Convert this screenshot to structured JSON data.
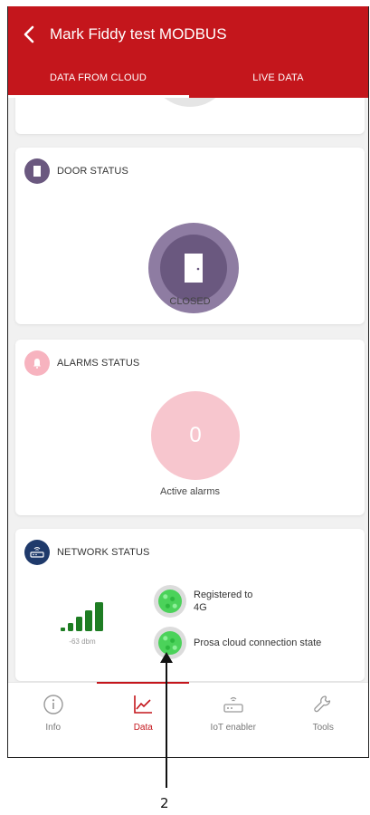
{
  "header": {
    "title": "Mark Fiddy test MODBUS",
    "tabs": [
      {
        "label": "DATA FROM CLOUD",
        "active": true
      },
      {
        "label": "LIVE DATA",
        "active": false
      }
    ]
  },
  "door": {
    "title": "DOOR STATUS",
    "state": "CLOSED",
    "icon": "door-icon"
  },
  "alarms": {
    "title": "ALARMS STATUS",
    "count": "0",
    "label": "Active alarms",
    "icon": "bell-icon"
  },
  "network": {
    "title": "NETWORK STATUS",
    "signal_strength": "-63 dbm",
    "icon": "router-icon",
    "statuses": [
      {
        "label": "Registered to 4G",
        "line1": "Registered to",
        "line2": "4G",
        "state": "green"
      },
      {
        "label": "Prosa cloud connection state",
        "state": "green"
      }
    ]
  },
  "bottom_nav": [
    {
      "label": "Info",
      "icon": "info-icon",
      "active": false
    },
    {
      "label": "Data",
      "icon": "chart-icon",
      "active": true
    },
    {
      "label": "IoT enabler",
      "icon": "router-icon",
      "active": false
    },
    {
      "label": "Tools",
      "icon": "wrench-icon",
      "active": false
    }
  ],
  "annotation": {
    "number": "2"
  },
  "colors": {
    "brand": "#c4161c",
    "door": "#6a587f",
    "alarm": "#f7c6ce",
    "signal": "#1e7d23",
    "status_ok": "#4bd25a"
  }
}
